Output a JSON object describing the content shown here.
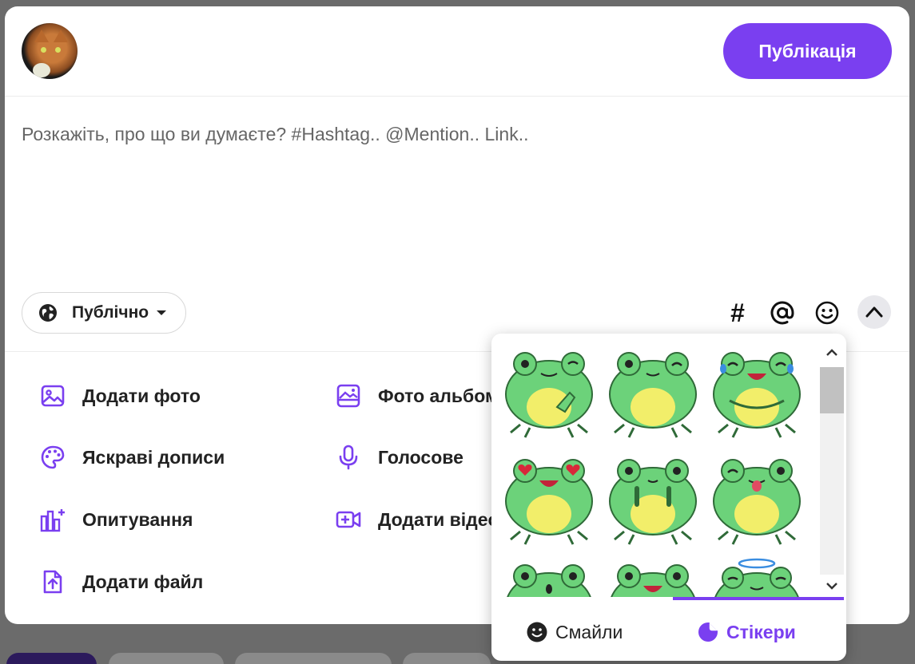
{
  "header": {
    "publish_label": "Публікація"
  },
  "composer": {
    "placeholder": "Розкажіть, про що ви думаєте? #Hashtag.. @Mention.. Link.."
  },
  "privacy": {
    "label": "Публічно"
  },
  "toolbar": {
    "hashtag_glyph": "#"
  },
  "actions": {
    "left": [
      "Додати фото",
      "Яскраві дописи",
      "Опитування",
      "Додати файл"
    ],
    "right": [
      "Фото альбом",
      "Голосове",
      "Додати відео"
    ]
  },
  "sticker_popup": {
    "tabs": {
      "smiles": "Смайли",
      "stickers": "Стікери"
    },
    "active_tab": "stickers"
  },
  "colors": {
    "accent": "#7a3ff0",
    "frog_green": "#6cd27a",
    "frog_belly": "#f2ee6a"
  }
}
